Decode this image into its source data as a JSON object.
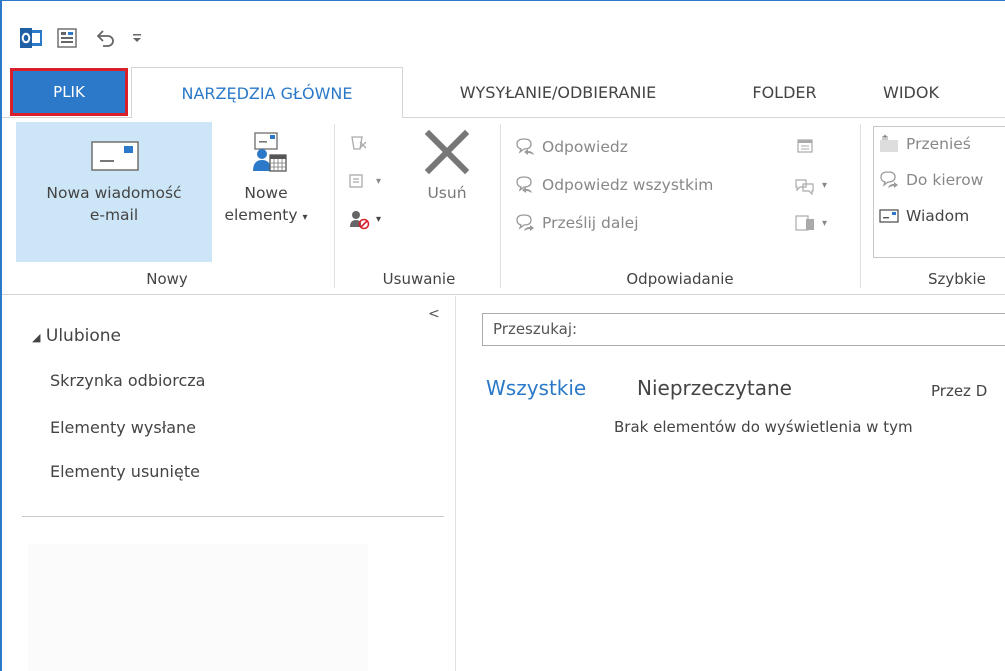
{
  "tabs": {
    "file": "PLIK",
    "home": "NARZĘDZIA GŁÓWNE",
    "send_receive": "WYSYŁANIE/ODBIERANIE",
    "folder": "FOLDER",
    "view": "WIDOK"
  },
  "ribbon": {
    "new_group": {
      "new_email_line1": "Nowa wiadomość",
      "new_email_line2": "e-mail",
      "new_items_line1": "Nowe",
      "new_items_line2": "elementy",
      "label": "Nowy"
    },
    "delete_group": {
      "delete": "Usuń",
      "label": "Usuwanie"
    },
    "respond_group": {
      "reply": "Odpowiedz",
      "reply_all": "Odpowiedz wszystkim",
      "forward": "Prześlij dalej",
      "label": "Odpowiadanie"
    },
    "quick_steps_group": {
      "move_to": "Przenieś",
      "to_manager": "Do kierow",
      "team_email": "Wiadom",
      "label": "Szybkie"
    }
  },
  "nav": {
    "favorites": "Ulubione",
    "items": [
      "Skrzynka odbiorcza",
      "Elementy wysłane",
      "Elementy usunięte"
    ]
  },
  "main": {
    "search_placeholder": "Przeszukaj:",
    "filter_all": "Wszystkie",
    "filter_unread": "Nieprzeczytane",
    "sort_by": "Przez D",
    "empty_message": "Brak elementów do wyświetlenia w tym"
  },
  "colors": {
    "accent": "#2b79c8",
    "file_tab_border": "#d9202a",
    "selected_button": "#cde6f7"
  },
  "icons": {
    "app": "outlook-icon",
    "qat1": "send-receive-icon",
    "qat2": "undo-icon",
    "qat3": "customize-qat-icon"
  }
}
